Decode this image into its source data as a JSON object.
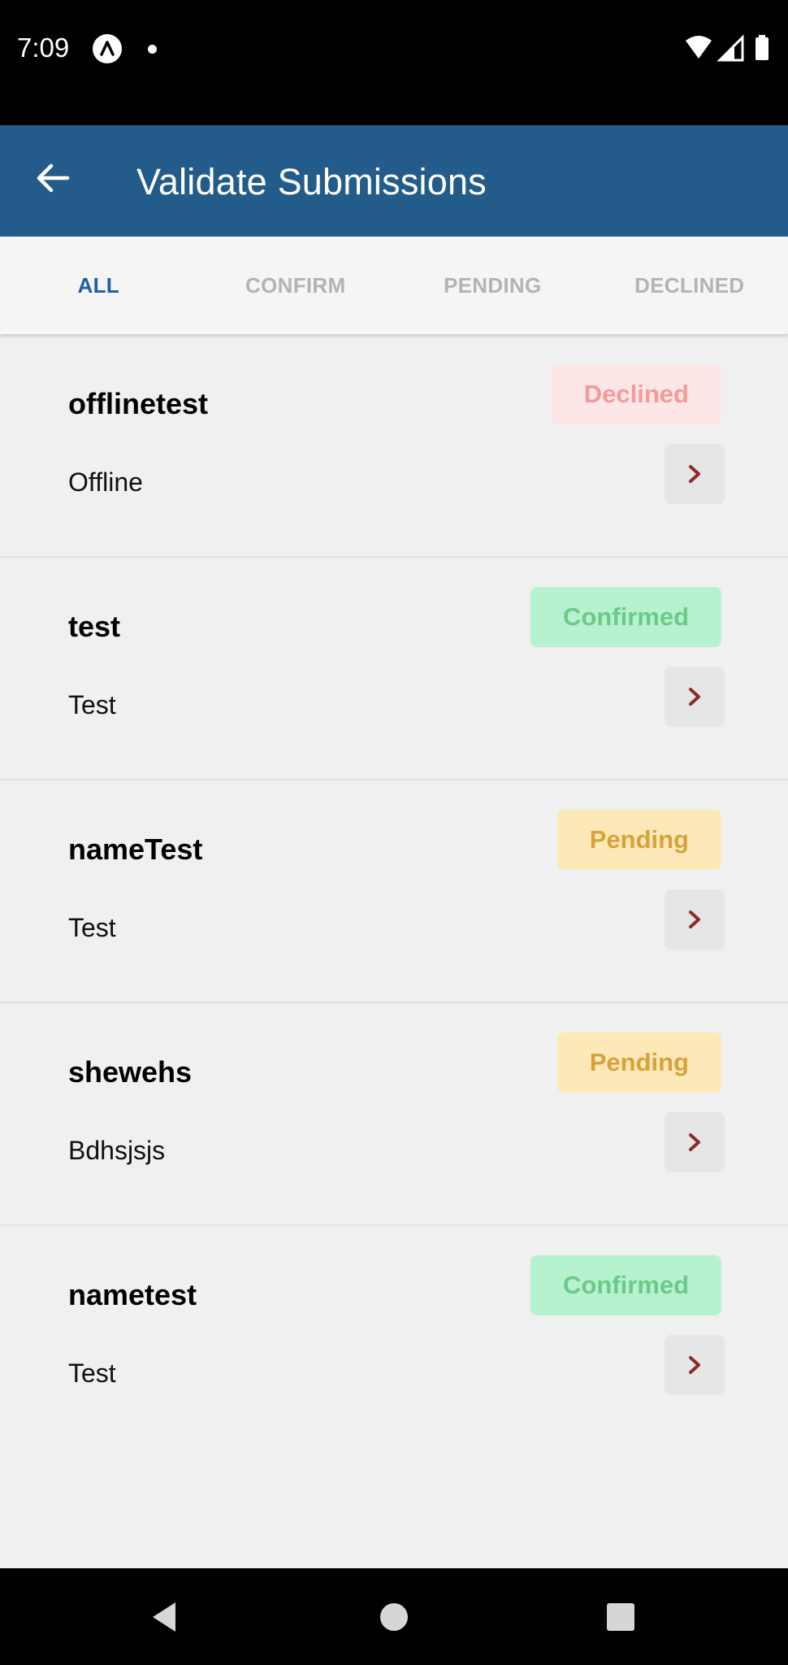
{
  "status_bar": {
    "time": "7:09",
    "icons": [
      "app-notification-icon",
      "dot-icon",
      "wifi-icon",
      "signal-icon",
      "battery-icon"
    ]
  },
  "app_bar": {
    "title": "Validate Submissions",
    "background": "#235b8a",
    "back_icon": "arrow-left-icon"
  },
  "tabs": [
    {
      "label": "ALL",
      "active": true
    },
    {
      "label": "CONFIRM",
      "active": false
    },
    {
      "label": "PENDING",
      "active": false
    },
    {
      "label": "DECLINED",
      "active": false
    }
  ],
  "colors": {
    "tab_active": "#1d5cab",
    "tab_inactive": "#b3b3b3",
    "chevron": "#8b2c2c",
    "declined_bg": "#fde6e6",
    "declined_text": "#f59a9a",
    "confirmed_bg": "#b6f2cf",
    "confirmed_text": "#6cc98a",
    "pending_bg": "#fde9b8",
    "pending_text": "#d8a23a"
  },
  "submissions": [
    {
      "title": "offlinetest",
      "subtitle": "Offline",
      "status": "Declined",
      "status_key": "declined"
    },
    {
      "title": "test",
      "subtitle": "Test",
      "status": "Confirmed",
      "status_key": "confirmed"
    },
    {
      "title": "nameTest",
      "subtitle": "Test",
      "status": "Pending",
      "status_key": "pending"
    },
    {
      "title": "shewehs",
      "subtitle": "Bdhsjsjs",
      "status": "Pending",
      "status_key": "pending"
    },
    {
      "title": "nametest",
      "subtitle": "Test",
      "status": "Confirmed",
      "status_key": "confirmed"
    }
  ],
  "nav_bar": {
    "icons": [
      "back-triangle-icon",
      "home-circle-icon",
      "recents-square-icon"
    ]
  }
}
